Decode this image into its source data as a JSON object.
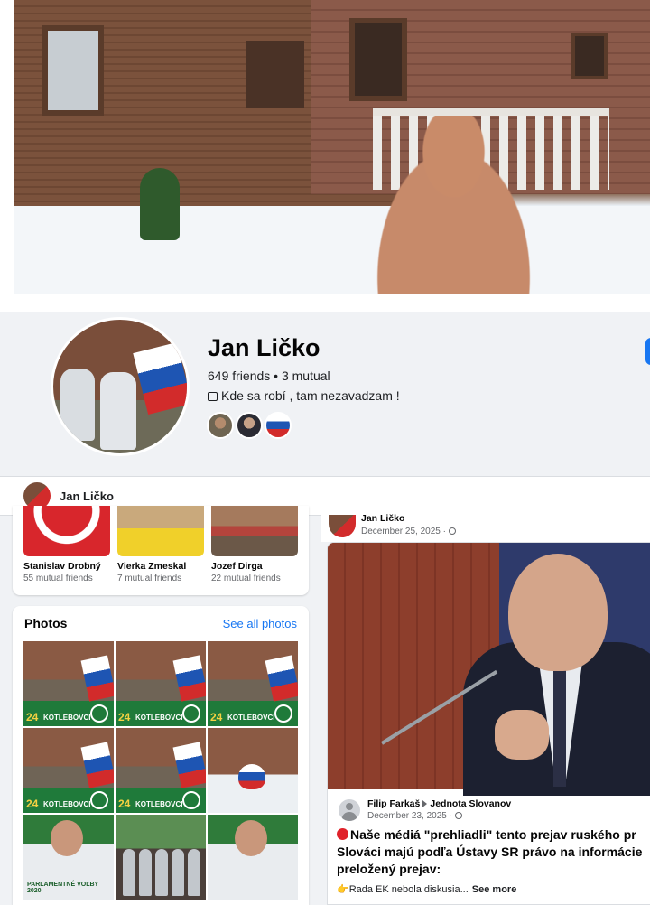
{
  "profile": {
    "name": "Jan Ličko",
    "friends_line": "649 friends • 3 mutual",
    "bio": "Kde sa robí , tam nezavadzam !",
    "bio_icon": "briefcase-icon",
    "mutual_friend_avatars": [
      "mutual-friend-avatar-1",
      "mutual-friend-avatar-2",
      "mutual-friend-avatar-3"
    ]
  },
  "sticky_header": {
    "name": "Jan Ličko"
  },
  "friends": [
    {
      "name": "Stanislav Drobný",
      "mutual": "55 mutual friends"
    },
    {
      "name": "Vierka Zmeskal",
      "mutual": "7 mutual friends"
    },
    {
      "name": "Jozef Dirga",
      "mutual": "22 mutual friends"
    }
  ],
  "photos": {
    "title": "Photos",
    "see_all": "See all photos",
    "tiles": [
      {
        "kind": "kotlebovci",
        "number": "24",
        "text": "KOTLEBOVCI"
      },
      {
        "kind": "kotlebovci",
        "number": "24",
        "text": "KOTLEBOVCI"
      },
      {
        "kind": "kotlebovci",
        "number": "24",
        "text": "KOTLEBOVCI"
      },
      {
        "kind": "kotlebovci",
        "number": "24",
        "text": "KOTLEBOVCI"
      },
      {
        "kind": "kotlebovci",
        "number": "24",
        "text": "KOTLEBOVCI"
      },
      {
        "kind": "house"
      },
      {
        "kind": "portrait",
        "badge": "PARLAMENTNÉ VOĽBY 2020"
      },
      {
        "kind": "group"
      },
      {
        "kind": "portrait",
        "badge": ""
      }
    ]
  },
  "post": {
    "author": "Jan Ličko",
    "date": "December 25, 2025 ·",
    "shared": {
      "author": "Filip Farkaš",
      "group": "Jednota Slovanov",
      "date": "December 23, 2025 ·",
      "text_line1": "Naše médiá \"prehliadli\" tento prejav ruského pr",
      "text_line2": "Slováci majú podľa Ústavy SR právo na informácie",
      "text_line3": "preložený prejav:",
      "sub_text": "👉Rada EK nebola diskusia...",
      "see_more": "See more"
    }
  },
  "colors": {
    "link": "#1877f2",
    "background": "#f0f2f5",
    "card": "#ffffff",
    "secondary_text": "#65676b"
  }
}
